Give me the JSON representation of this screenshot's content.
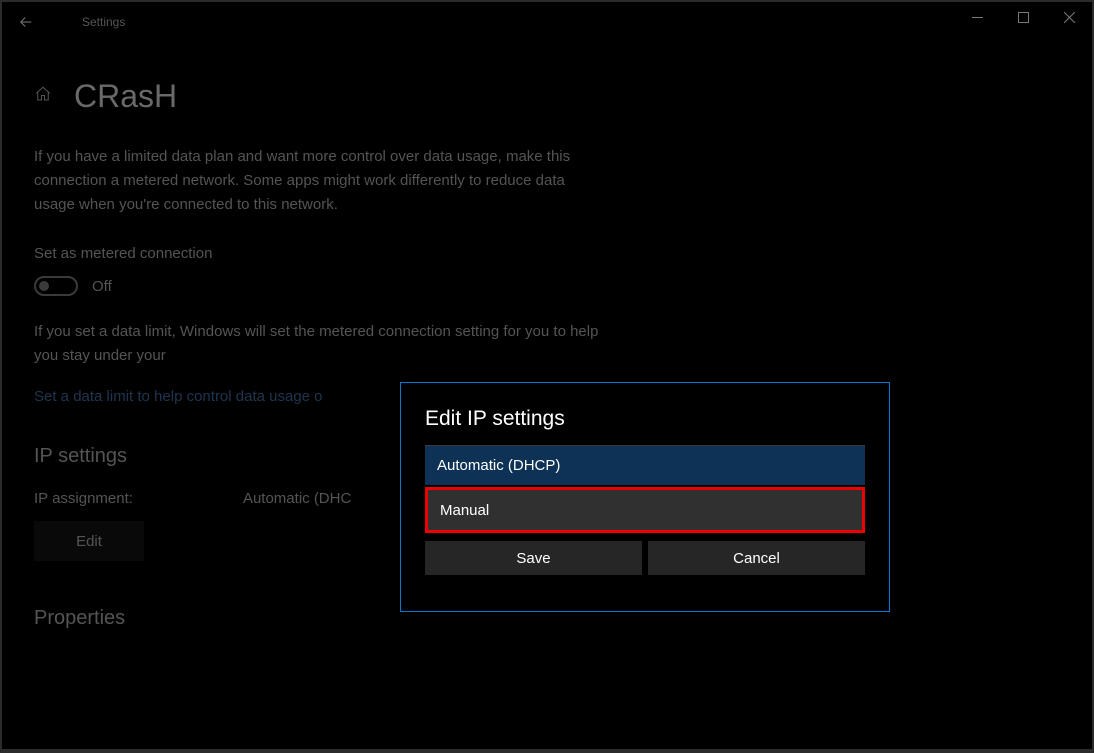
{
  "titlebar": {
    "app_title": "Settings"
  },
  "page": {
    "heading": "CRasH",
    "description": "If you have a limited data plan and want more control over data usage, make this connection a metered network. Some apps might work differently to reduce data usage when you're connected to this network.",
    "metered_label": "Set as metered connection",
    "toggle_state": "Off",
    "data_limit_text": "If you set a data limit, Windows will set the metered connection setting for you to help you stay under your",
    "data_limit_link": "Set a data limit to help control data usage o",
    "ip_heading": "IP settings",
    "ip_assignment_label": "IP assignment:",
    "ip_assignment_value": "Automatic (DHC",
    "edit_label": "Edit",
    "properties_heading": "Properties"
  },
  "dialog": {
    "title": "Edit IP settings",
    "option_auto": "Automatic (DHCP)",
    "option_manual": "Manual",
    "save": "Save",
    "cancel": "Cancel"
  }
}
